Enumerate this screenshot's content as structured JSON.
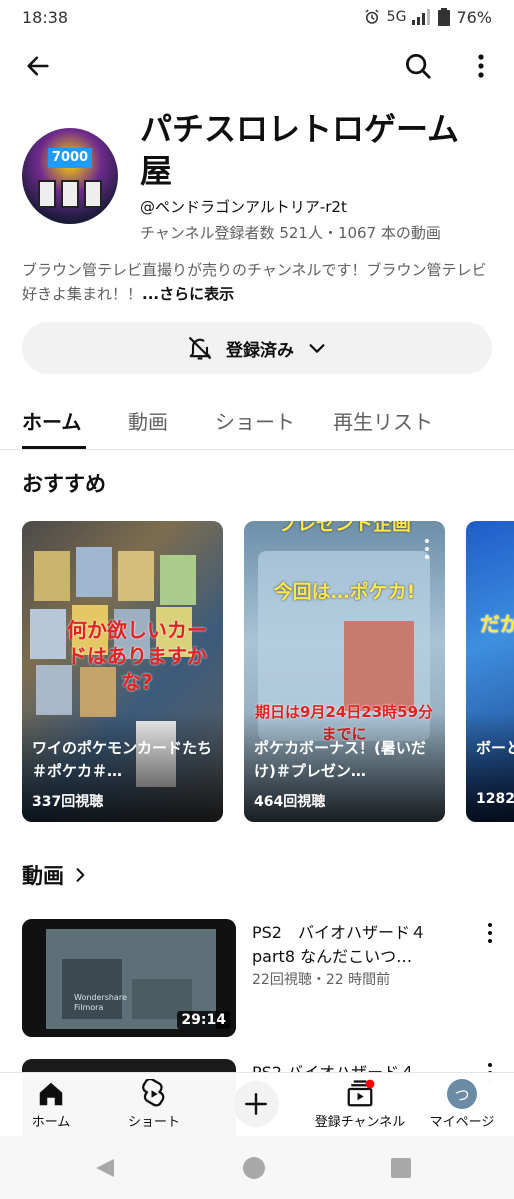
{
  "status_bar": {
    "time": "18:38",
    "network": "5G",
    "battery": "76%"
  },
  "channel": {
    "title": "パチスロレトロゲーム屋",
    "handle": "@ペンドラゴンアルトリア-r2t",
    "stats": "チャンネル登録者数 521人・1067 本の動画",
    "avatar_text": "7000",
    "description": "ブラウン管テレビ直撮りが売りのチャンネルです！ブラウン管テレビ好きよ集まれ！！",
    "more_label": "...さらに表示",
    "subscribe_label": "登録済み"
  },
  "tabs": [
    {
      "label": "ホーム",
      "active": true
    },
    {
      "label": "動画"
    },
    {
      "label": "ショート"
    },
    {
      "label": "再生リスト"
    }
  ],
  "recommended": {
    "title": "おすすめ",
    "shorts": [
      {
        "title": "ワイのポケモンカードたち＃ポケカ＃…",
        "views": "337回視聴",
        "overlay": "何か欲しいカードはありますかな?"
      },
      {
        "title": "ポケカボーナス！(暑いだけ)＃プレゼン…",
        "views": "464回視聴",
        "overlay_top": "プレゼント企画",
        "overlay_mid": "今回は…ポケカ!",
        "overlay_bottom": "期日は9月24日23時59分までに"
      },
      {
        "title": "ボーと無",
        "views": "1282",
        "overlay": "だか"
      }
    ]
  },
  "videos_section": {
    "title": "動画",
    "items": [
      {
        "title": "PS2　バイオハザード４　part8 なんだこいつ…",
        "meta": "22回視聴・22 時間前",
        "duration": "29:14",
        "watermark": "Wondershare Filmora"
      },
      {
        "title": "PS2 バイオハザード４",
        "meta": ""
      }
    ]
  },
  "bottom_nav": [
    {
      "label": "ホーム",
      "icon": "home-icon"
    },
    {
      "label": "ショート",
      "icon": "shorts-icon"
    },
    {
      "label": "",
      "icon": "plus-icon"
    },
    {
      "label": "登録チャンネル",
      "icon": "subscriptions-icon"
    },
    {
      "label": "マイページ",
      "icon": "avatar-icon",
      "avatar_char": "つ"
    }
  ],
  "colors": {
    "accent": "#0f0f0f",
    "secondary_text": "#606060",
    "notification_dot": "#ff0000",
    "overlay_red": "#e32222"
  }
}
